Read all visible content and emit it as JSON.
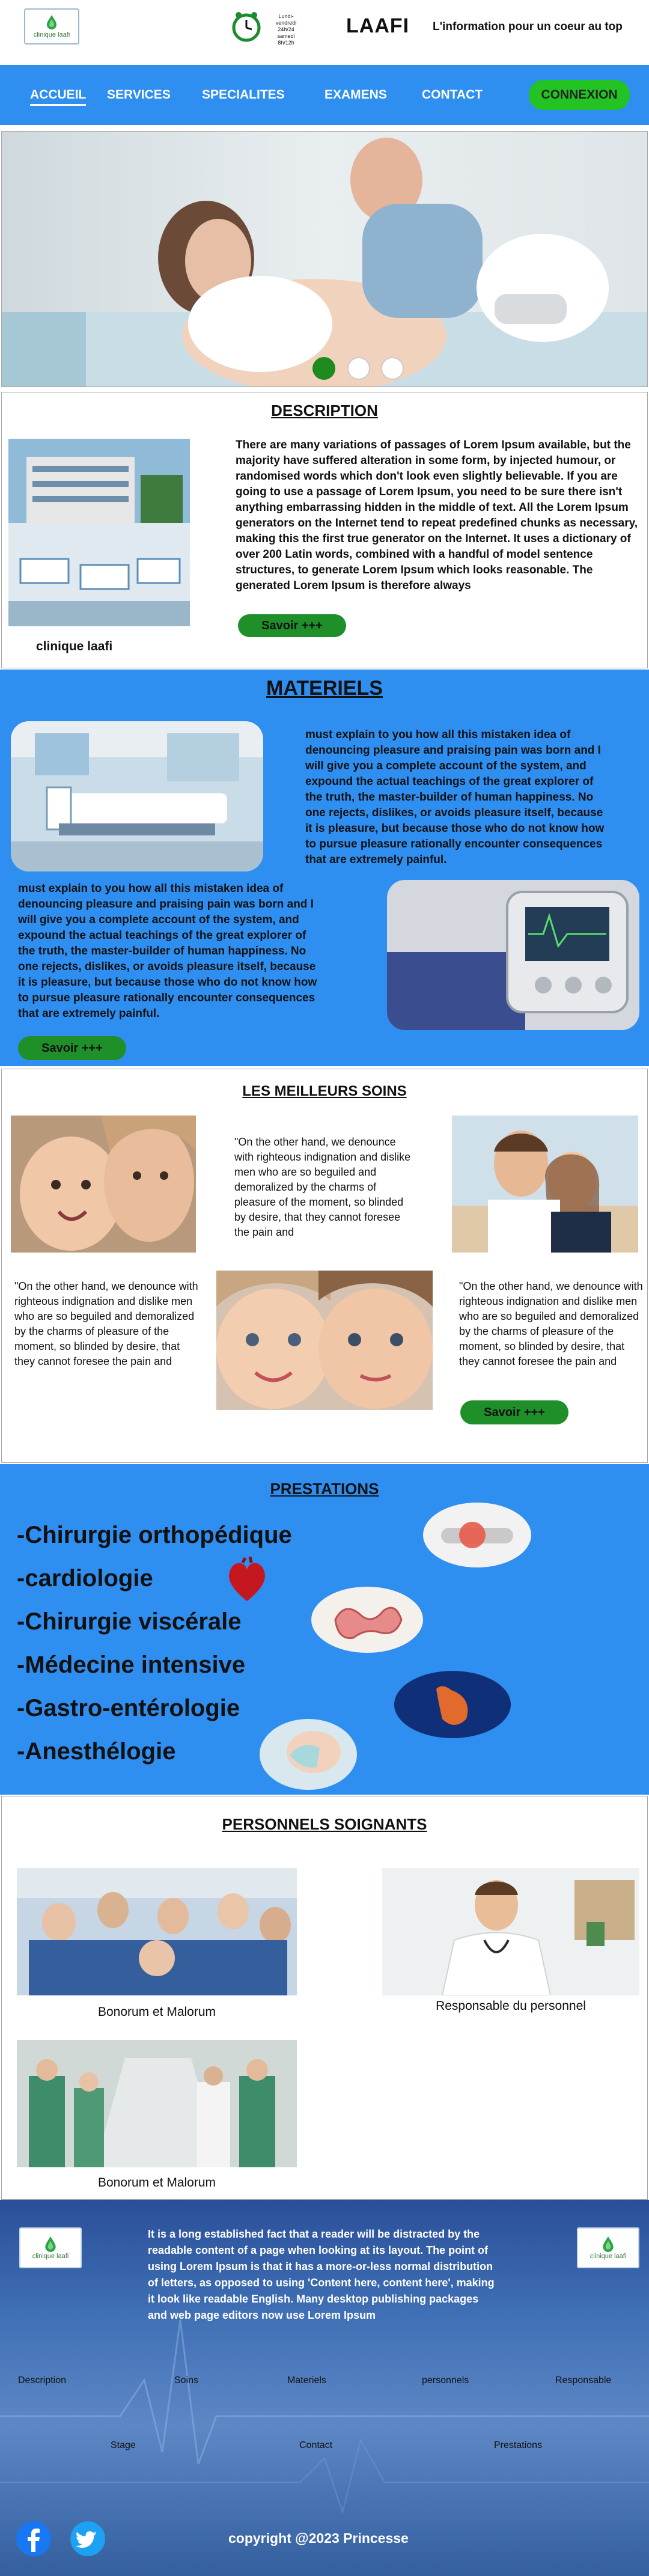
{
  "header": {
    "logo_text": "clinique laafi",
    "clock_text": "Lundi-vendredi 24h/24 samedi 8h/12h",
    "site_name": "LAAFI",
    "tagline": "L'information pour un coeur au top"
  },
  "nav": {
    "items": [
      "ACCUEIL",
      "SERVICES",
      "SPECIALITES",
      "EXAMENS",
      "CONTACT"
    ],
    "login": "CONNEXION"
  },
  "colors": {
    "primary_blue": "#2f8ff0",
    "green": "#22c322",
    "dark_green": "#1f8f2a"
  },
  "description": {
    "title": "DESCRIPTION",
    "text": "There are many variations of passages of Lorem Ipsum available, but the majority have suffered alteration in some form, by injected humour, or randomised words which don't look even slightly believable. If you are going to use a passage of Lorem Ipsum, you need to be sure there isn't anything embarrassing hidden in the middle of text. All the Lorem Ipsum generators on the Internet tend to repeat predefined chunks as necessary, making this the first true generator on the Internet. It uses a dictionary of over 200 Latin words, combined with a handful of model sentence structures, to generate Lorem Ipsum which looks reasonable. The generated Lorem Ipsum is therefore always",
    "caption": "clinique laafi",
    "button": "Savoir +++"
  },
  "materiels": {
    "title": "MATERIELS",
    "text1": "must explain to you how all this mistaken idea of denouncing pleasure and praising pain was born and I will give you a complete account of the system, and expound the actual teachings of the great explorer of the truth, the master-builder of human happiness. No one rejects, dislikes, or avoids pleasure itself, because it is pleasure, but because those who do not know how to pursue pleasure rationally encounter consequences that are extremely painful.",
    "text2": "must explain to you how all this mistaken idea of denouncing pleasure and praising pain was born and I will give you a complete account of the system, and expound the actual teachings of the great explorer of the truth, the master-builder of human happiness. No one rejects, dislikes, or avoids pleasure itself, because it is pleasure, but because those who do not know how to pursue pleasure rationally encounter consequences that are extremely painful.",
    "button": "Savoir +++"
  },
  "soins": {
    "title": "LES MEILLEURS SOINS",
    "text_a": "\"On the other hand, we denounce with righteous indignation and dislike men who are so beguiled and demoralized by the charms of pleasure of the moment, so blinded by desire, that they cannot foresee the pain and",
    "text_b": "\"On the other hand, we denounce with righteous indignation and dislike men who are so beguiled and demoralized by the charms of pleasure of the moment, so blinded by desire, that they cannot foresee the pain and",
    "text_c": "\"On the other hand, we denounce with righteous indignation and dislike men who are so beguiled and demoralized by the charms of pleasure of the moment, so blinded by desire, that they cannot foresee the pain and",
    "button": "Savoir +++"
  },
  "prestations": {
    "title": "PRESTATIONS",
    "items": [
      "-Chirurgie orthopédique",
      "-cardiologie",
      "-Chirurgie viscérale",
      "-Médecine intensive",
      "-Gastro-entérologie",
      "-Anesthélogie"
    ]
  },
  "personnels": {
    "title": "PERSONNELS SOIGNANTS",
    "caption1": "Bonorum et Malorum",
    "caption2": "Responsable du personnel",
    "caption3": "Bonorum et Malorum"
  },
  "footer": {
    "logo_text": "clinique laafi",
    "text": "It is a long established fact that a reader will be distracted by the readable content of a page when looking at its layout. The point of using Lorem Ipsum is that it has a more-or-less normal distribution of letters, as opposed to using 'Content here, content here', making it look like readable English. Many desktop publishing packages and web page editors now use Lorem Ipsum",
    "links_row1": [
      "Description",
      "Soins",
      "Materiels",
      "personnels",
      "Responsable"
    ],
    "links_row2": [
      "Stage",
      "Contact",
      "Prestations"
    ],
    "copyright": "copyright @2023 Princesse",
    "social_icons": [
      "facebook-icon",
      "twitter-icon"
    ]
  }
}
